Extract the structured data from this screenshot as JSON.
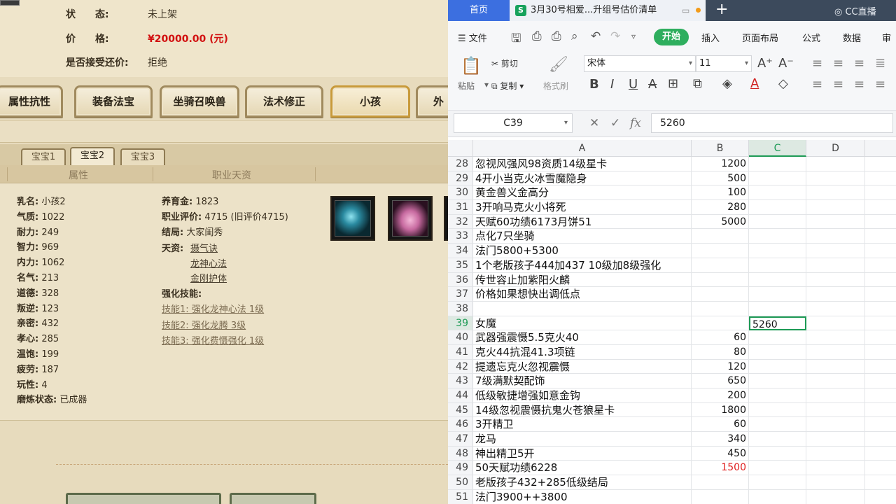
{
  "game": {
    "status_label": "状　　态:",
    "status_value": "未上架",
    "price_label": "价　　格:",
    "price_value": "¥20000.00 (元)",
    "bargain_label": "是否接受还价:",
    "bargain_value": "拒绝",
    "tabs": [
      "属性抗性",
      "装备法宝",
      "坐骑召唤兽",
      "法术修正",
      "小孩",
      "外"
    ],
    "active_tab": "小孩",
    "subtabs": [
      "宝宝1",
      "宝宝2",
      "宝宝3"
    ],
    "active_subtab": "宝宝2",
    "col_headers": [
      "属性",
      "职业天资"
    ],
    "left_attrs": [
      {
        "k": "乳名:",
        "v": "小孩2"
      },
      {
        "k": "气质:",
        "v": "1022"
      },
      {
        "k": "耐力:",
        "v": "249"
      },
      {
        "k": "智力:",
        "v": "969"
      },
      {
        "k": "内力:",
        "v": "1062"
      },
      {
        "k": "名气:",
        "v": "213"
      },
      {
        "k": "道德:",
        "v": "328"
      },
      {
        "k": "叛逆:",
        "v": "123"
      },
      {
        "k": "亲密:",
        "v": "432"
      },
      {
        "k": "孝心:",
        "v": "285"
      },
      {
        "k": "温饱:",
        "v": "199"
      },
      {
        "k": "疲劳:",
        "v": "187"
      },
      {
        "k": "玩性:",
        "v": "4"
      },
      {
        "k": "磨炼状态:",
        "v": "已成器"
      }
    ],
    "raise_money": {
      "k": "养育金:",
      "v": "1823"
    },
    "career_eval": {
      "k": "职业评价:",
      "v": "4715 (旧评价4715)"
    },
    "ending": {
      "k": "结局:",
      "v": "大家闺秀"
    },
    "talent_label": "天资:",
    "talents": [
      "摄气诀",
      "龙神心法",
      "金刚护体"
    ],
    "enhance_label": "强化技能:",
    "enhance_skills": [
      "技能1: 强化龙神心法 1级",
      "技能2: 强化龙腾 3级",
      "技能3: 强化费慑强化 1级"
    ]
  },
  "wps": {
    "home_tab": "首页",
    "doc_tab_title": "3月30号相爱...升组号估价清单",
    "doc_tab_icon": "S",
    "brand": "CC直播",
    "menu_file": "文件",
    "menu_start": "开始",
    "menus": [
      "插入",
      "页面布局",
      "公式",
      "数据",
      "审"
    ],
    "paste": "粘贴",
    "cut": "剪切",
    "copy": "复制",
    "format_painter": "格式刷",
    "font_name": "宋体",
    "font_size": "11",
    "name_box": "C39",
    "formula_value": "5260",
    "columns": [
      "A",
      "B",
      "C",
      "D"
    ],
    "selected_column": "C",
    "rows": [
      {
        "n": "28",
        "a": "忽视风强风98资质14级星卡",
        "b": "1200",
        "c": ""
      },
      {
        "n": "29",
        "a": "4开小当克火冰雪魔隐身",
        "b": "500",
        "c": ""
      },
      {
        "n": "30",
        "a": "黄金兽义金高分",
        "b": "100",
        "c": ""
      },
      {
        "n": "31",
        "a": "3开响马克火小将死",
        "b": "280",
        "c": ""
      },
      {
        "n": "32",
        "a": "天赋60功绩6173月饼51",
        "b": "5000",
        "c": ""
      },
      {
        "n": "33",
        "a": "点化7只坐骑",
        "b": "",
        "c": ""
      },
      {
        "n": "34",
        "a": "法门5800+5300",
        "b": "",
        "c": ""
      },
      {
        "n": "35",
        "a": "1个老版孩子444加437 10级加8级强化",
        "b": "",
        "c": ""
      },
      {
        "n": "36",
        "a": "传世容止加紫阳火麟",
        "b": "",
        "c": ""
      },
      {
        "n": "37",
        "a": "价格如果想快出调低点",
        "b": "",
        "c": ""
      },
      {
        "n": "38",
        "a": "",
        "b": "",
        "c": ""
      },
      {
        "n": "39",
        "a": "女魔",
        "b": "",
        "c": "5260"
      },
      {
        "n": "40",
        "a": "武器强震慑5.5克火40",
        "b": "60",
        "c": ""
      },
      {
        "n": "41",
        "a": "克火44抗混41.3项链",
        "b": "80",
        "c": ""
      },
      {
        "n": "42",
        "a": "提遗忘克火忽视震慑",
        "b": "120",
        "c": ""
      },
      {
        "n": "43",
        "a": "7级满默契配饰",
        "b": "650",
        "c": ""
      },
      {
        "n": "44",
        "a": "低级敏捷增强如意金钩",
        "b": "200",
        "c": ""
      },
      {
        "n": "45",
        "a": "14级忽视震慑抗鬼火苍狼星卡",
        "b": "1800",
        "c": ""
      },
      {
        "n": "46",
        "a": "3开精卫",
        "b": "60",
        "c": ""
      },
      {
        "n": "47",
        "a": "龙马",
        "b": "340",
        "c": ""
      },
      {
        "n": "48",
        "a": "神出精卫5开",
        "b": "450",
        "c": ""
      },
      {
        "n": "49",
        "a": "50天赋功绩6228",
        "b": "1500",
        "c": "",
        "red": true
      },
      {
        "n": "50",
        "a": "老版孩子432+285低级结局",
        "b": "",
        "c": ""
      },
      {
        "n": "51",
        "a": "法门3900++3800",
        "b": "",
        "c": ""
      }
    ]
  }
}
